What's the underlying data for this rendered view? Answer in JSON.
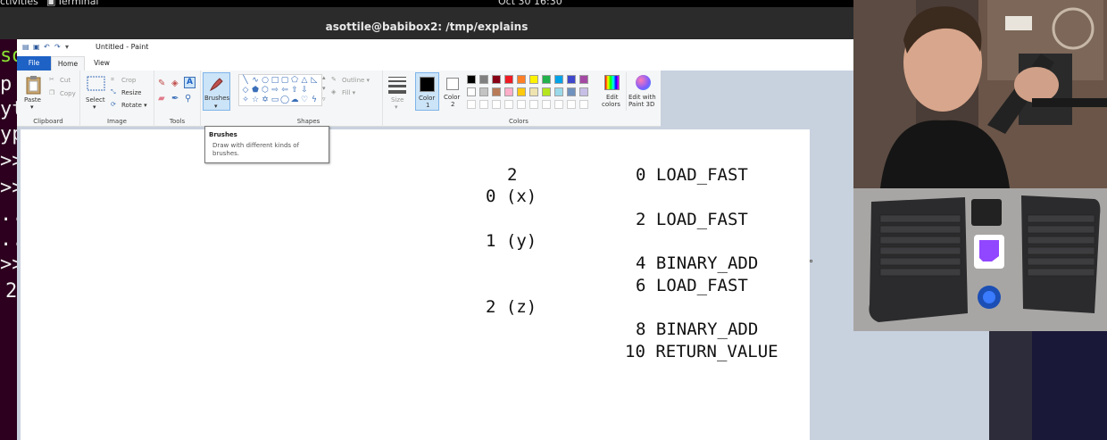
{
  "topbar": {
    "activities": "ctivities",
    "app_name": "Terminal",
    "clock": "Oct 30  16:30"
  },
  "terminal": {
    "title": "asottile@babibox2: /tmp/explains",
    "visible_fragments": [
      "so",
      "p",
      "yt",
      "yp",
      ">>",
      ">>",
      "..",
      "..",
      ">>",
      "2"
    ]
  },
  "paint": {
    "title": "Untitled - Paint",
    "tabs": {
      "file": "File",
      "home": "Home",
      "view": "View"
    },
    "clipboard": {
      "paste": "Paste",
      "cut": "Cut",
      "copy": "Copy",
      "label": "Clipboard"
    },
    "image": {
      "select": "Select",
      "crop": "Crop",
      "resize": "Resize",
      "rotate": "Rotate",
      "label": "Image"
    },
    "tools": {
      "label": "Tools"
    },
    "brushes": {
      "label": "Brushes"
    },
    "shapes": {
      "outline": "Outline",
      "fill": "Fill",
      "label": "Shapes"
    },
    "size": {
      "label": "Size"
    },
    "colors": {
      "color1_label": "Color",
      "color1_num": "1",
      "color2_label": "Color",
      "color2_num": "2",
      "edit_colors_line1": "Edit",
      "edit_colors_line2": "colors",
      "paint3d_line1": "Edit with",
      "paint3d_line2": "Paint 3D",
      "label": "Colors",
      "color1_value": "#000000",
      "color2_value": "#ffffff",
      "palette_row1": [
        "#000000",
        "#7f7f7f",
        "#880015",
        "#ed1c24",
        "#ff7f27",
        "#fff200",
        "#22b14c",
        "#00a2e8",
        "#3f48cc",
        "#a349a4"
      ],
      "palette_row2": [
        "#ffffff",
        "#c3c3c3",
        "#b97a57",
        "#ffaec9",
        "#ffc90e",
        "#efe4b0",
        "#b5e61d",
        "#99d9ea",
        "#7092be",
        "#c8bfe7"
      ]
    },
    "tooltip": {
      "title": "Brushes",
      "body": "Draw with different kinds of brushes."
    },
    "canvas": {
      "stack_values": [
        "2",
        "0 (x)",
        "1 (y)",
        "2 (z)"
      ],
      "bytecode": [
        "0 LOAD_FAST",
        "2 LOAD_FAST",
        "4 BINARY_ADD",
        "6 LOAD_FAST",
        "8 BINARY_ADD",
        "10 RETURN_VALUE"
      ]
    }
  }
}
